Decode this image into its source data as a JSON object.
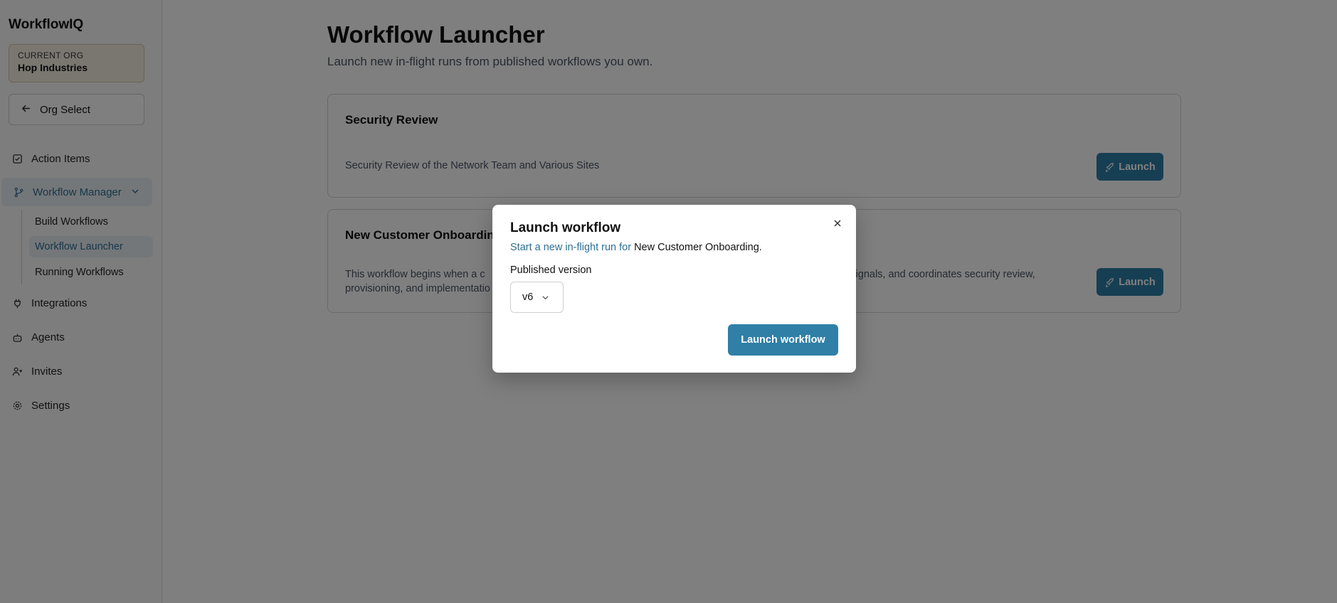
{
  "sidebar": {
    "brand": "WorkflowIQ",
    "org": {
      "label": "CURRENT ORG",
      "name": "Hop Industries"
    },
    "org_select": "Org Select",
    "items": [
      {
        "label": "Action Items",
        "icon": "checkbox-icon"
      },
      {
        "label": "Workflow Manager",
        "icon": "git-branch-icon"
      },
      {
        "label": "Integrations",
        "icon": "plug-icon"
      },
      {
        "label": "Agents",
        "icon": "bot-icon"
      },
      {
        "label": "Invites",
        "icon": "user-plus-icon"
      },
      {
        "label": "Settings",
        "icon": "gear-icon"
      }
    ],
    "subitems": [
      {
        "label": "Build Workflows"
      },
      {
        "label": "Workflow Launcher"
      },
      {
        "label": "Running Workflows"
      }
    ]
  },
  "main": {
    "title": "Workflow Launcher",
    "subtitle": "Launch new in-flight runs from published workflows you own.",
    "cards": [
      {
        "title": "Security Review",
        "description": "Security Review of the Network Team and Various Sites",
        "button": "Launch"
      },
      {
        "title": "New Customer Onboarding",
        "description_line1_left": "This workflow begins when a c",
        "description_line1_right": "k signals, and coordinates security review,",
        "description_line2": "provisioning, and implementatio",
        "button": "Launch"
      }
    ]
  },
  "modal": {
    "title": "Launch workflow",
    "subtitle_prefix": "Start a new in-flight run for ",
    "subtitle_workflow": "New Customer Onboarding",
    "subtitle_suffix": ".",
    "field_label": "Published version",
    "selected_version": "v6",
    "submit": "Launch workflow"
  },
  "colors": {
    "accent": "#2f7fa7",
    "active_text": "#2f6f93",
    "active_bg": "#e8eef3",
    "org_card_bg": "#f5efe2"
  }
}
